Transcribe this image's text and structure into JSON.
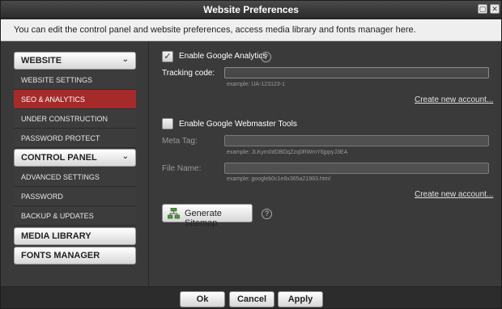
{
  "window": {
    "title": "Website Preferences",
    "maximize_icon": "maximize-icon",
    "close_icon": "close-icon"
  },
  "info": {
    "text": "You can edit the control panel and website preferences, access media library and fonts manager here."
  },
  "sidebar": {
    "website": {
      "label": "WEBSITE",
      "items": [
        "WEBSITE SETTINGS",
        "SEO & ANALYTICS",
        "UNDER CONSTRUCTION",
        "PASSWORD PROTECT"
      ],
      "active": "SEO & ANALYTICS"
    },
    "control_panel": {
      "label": "CONTROL PANEL",
      "items": [
        "ADVANCED SETTINGS",
        "PASSWORD",
        "BACKUP & UPDATES"
      ]
    },
    "media_library": {
      "label": "MEDIA LIBRARY"
    },
    "fonts_manager": {
      "label": "FONTS MANAGER"
    }
  },
  "main": {
    "analytics": {
      "checkbox_label": "Enable Google Analytics",
      "checked": true,
      "tracking_label": "Tracking code:",
      "tracking_value": "",
      "tracking_example": "example: UA-123123-1",
      "create_link": "Create new account..."
    },
    "webmaster": {
      "checkbox_label": "Enable Google Webmaster Tools",
      "checked": false,
      "meta_label": "Meta Tag:",
      "meta_value": "",
      "meta_example": "example: JLKym0dDBDqZzq0RWmY6jppyJ3EA",
      "file_label": "File Name:",
      "file_value": "",
      "file_example": "example: googleb0c1e8x365a21983.html",
      "create_link": "Create new account..."
    },
    "sitemap_button": "Generate Sitemap"
  },
  "footer": {
    "ok": "Ok",
    "cancel": "Cancel",
    "apply": "Apply"
  },
  "colors": {
    "active_item": "#a62a2a",
    "background": "#3a3a3a"
  }
}
